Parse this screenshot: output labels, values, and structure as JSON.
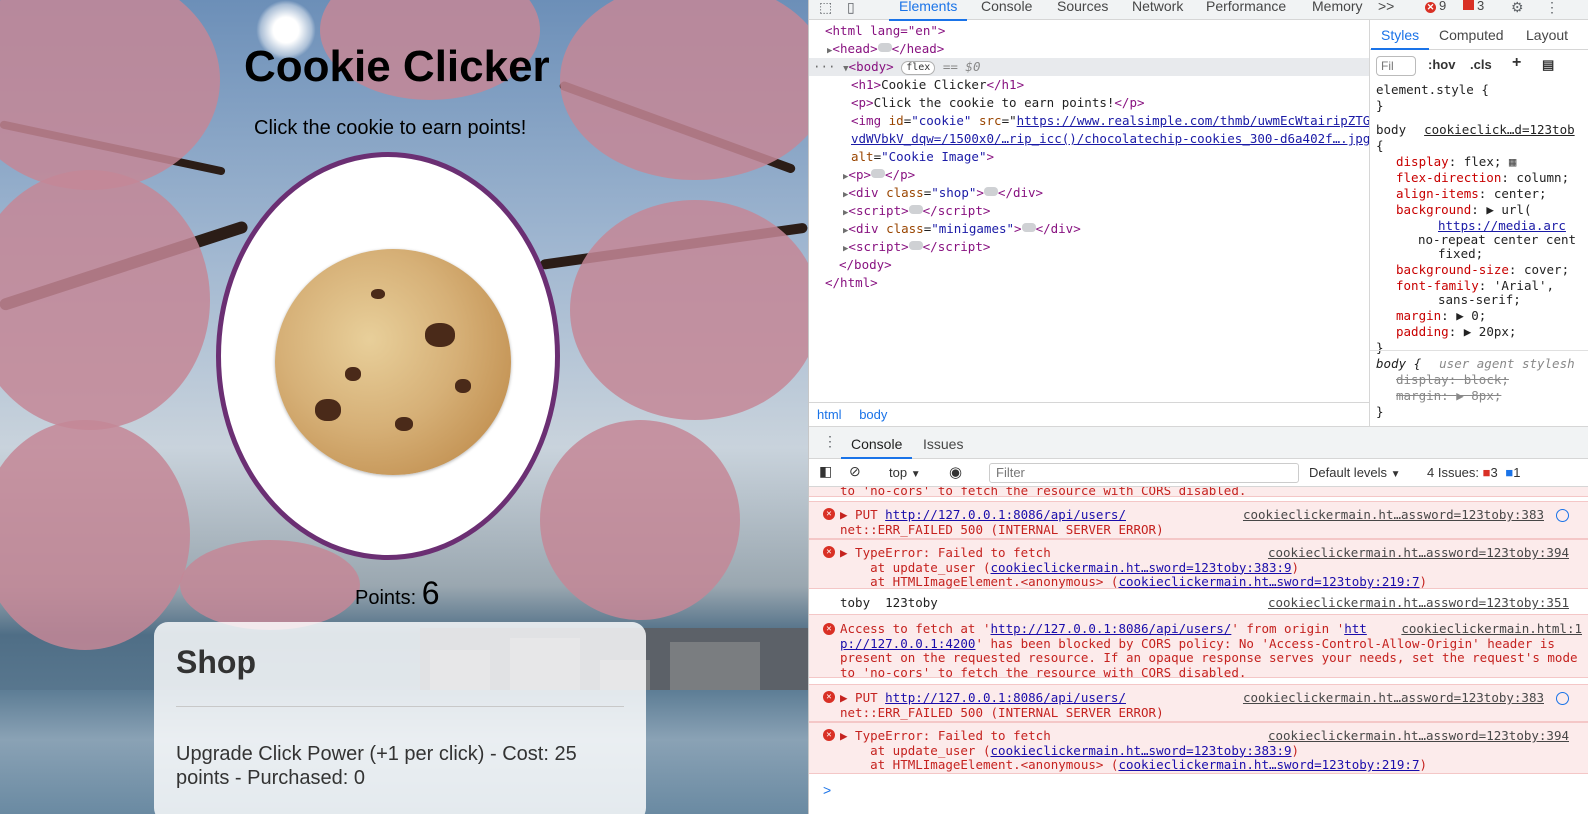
{
  "page": {
    "title": "Cookie Clicker",
    "subtitle": "Click the cookie to earn points!",
    "points_label": "Points:",
    "points_value": "6",
    "shop": {
      "title": "Shop",
      "item": "Upgrade Click Power (+1 per click) - Cost: 25 points - Purchased: 0"
    }
  },
  "devtools": {
    "tabs": [
      "Elements",
      "Console",
      "Sources",
      "Network",
      "Performance",
      "Memory"
    ],
    "active_tab": "Elements",
    "more_tabs": ">>",
    "error_count": "9",
    "warning_count": "3",
    "dom": {
      "html_open": "<html lang=\"en\">",
      "head": "head",
      "body_tag": "body",
      "body_pill": "flex",
      "body_eq": "== $0",
      "h1_open": "<h1>",
      "h1_text": "Cookie Clicker",
      "h1_close": "</h1>",
      "p_open": "<p>",
      "p_text": "Click the cookie to earn points!",
      "p_close": "</p>",
      "img_prefix": "<img ",
      "img_id_attr": "id",
      "img_id_val": "\"cookie\"",
      "img_src_attr": "src",
      "img_src_1": "https://www.realsimple.com/thmb/uwmEcWtairipZTGa",
      "img_src_2": "vdWVbkV_dqw=/1500x0/…rip_icc()/chocolatechip-cookies_300-d6a402f….jpg",
      "img_alt_attr": "alt",
      "img_alt_val": "\"Cookie Image\"",
      "img_close": ">",
      "p2": "p",
      "div_shop_class": "\"shop\"",
      "script": "script",
      "div_mini_class": "\"minigames\"",
      "body_close": "</body>",
      "html_close": "</html>"
    },
    "breadcrumbs": [
      "html",
      "body"
    ],
    "styles": {
      "tabs": [
        "Styles",
        "Computed",
        "Layout"
      ],
      "filter_placeholder": "Fil",
      "hov": ":hov",
      "cls": ".cls",
      "element_style": "element.style {",
      "close_brace": "}",
      "body_selector": "body",
      "body_source": "cookieclick…d=123tob",
      "open_brace": "{",
      "rules": [
        {
          "name": "display",
          "value": "flex;"
        },
        {
          "name": "flex-direction",
          "value": "column;"
        },
        {
          "name": "align-items",
          "value": "center;"
        },
        {
          "name": "background",
          "value": "▶ url("
        },
        {
          "name": "",
          "value": "https://media.arc"
        },
        {
          "name": "",
          "value": "no-repeat center cent"
        },
        {
          "name": "",
          "value": "fixed;"
        },
        {
          "name": "background-size",
          "value": "cover;"
        },
        {
          "name": "font-family",
          "value": "'Arial',"
        },
        {
          "name": "",
          "value": "sans-serif;"
        },
        {
          "name": "margin",
          "value": "▶ 0;"
        },
        {
          "name": "padding",
          "value": "▶ 20px;"
        }
      ],
      "ua_selector": "body {",
      "ua_label": "user agent stylesh",
      "ua_rules": [
        {
          "name": "display",
          "value": "block;"
        },
        {
          "name": "margin",
          "value": "▶ 8px;"
        }
      ]
    },
    "console": {
      "tabs": [
        "Console",
        "Issues"
      ],
      "context": "top",
      "filter_placeholder": "Filter",
      "levels": "Default levels",
      "issues_label": "4 Issues:",
      "issues_errors": "3",
      "issues_info": "1",
      "partial_line": "to 'no-cors' to fetch the resource with CORS disabled.",
      "messages": [
        {
          "type": "error",
          "lines": [
            "▶ PUT ",
            "net::ERR_FAILED 500 (INTERNAL SERVER ERROR)"
          ],
          "url": "http://127.0.0.1:8086/api/users/",
          "source": "cookieclickermain.ht…assword=123toby:383"
        },
        {
          "type": "error",
          "lines": [
            "▶ TypeError: Failed to fetch",
            "    at update_user (",
            "    at HTMLImageElement.<anonymous> ("
          ],
          "links": [
            "cookieclickermain.ht…sword=123toby:383:9",
            "cookieclickermain.ht…sword=123toby:219:7"
          ],
          "source": "cookieclickermain.ht…assword=123toby:394"
        },
        {
          "type": "log",
          "text": "toby  123toby",
          "source": "cookieclickermain.ht…assword=123toby:351"
        },
        {
          "type": "error",
          "lines": [
            "Access to fetch at '",
            "' from origin '",
            "htt",
            "p://127.0.0.1:4200",
            "' has been blocked by CORS policy: No 'Access-Control-Allow-Origin' header is",
            "present on the requested resource. If an opaque response serves your needs, set the request's mode",
            "to 'no-cors' to fetch the resource with CORS disabled."
          ],
          "url": "http://127.0.0.1:8086/api/users/",
          "source": "cookieclickermain.html:1"
        },
        {
          "type": "error",
          "lines": [
            "▶ PUT ",
            "net::ERR_FAILED 500 (INTERNAL SERVER ERROR)"
          ],
          "url": "http://127.0.0.1:8086/api/users/",
          "source": "cookieclickermain.ht…assword=123toby:383"
        },
        {
          "type": "error",
          "lines": [
            "▶ TypeError: Failed to fetch",
            "    at update_user (",
            "    at HTMLImageElement.<anonymous> ("
          ],
          "links": [
            "cookieclickermain.ht…sword=123toby:383:9",
            "cookieclickermain.ht…sword=123toby:219:7"
          ],
          "source": "cookieclickermain.ht…assword=123toby:394"
        }
      ],
      "prompt": ">"
    }
  },
  "colors": {
    "accent": "#1a73e8",
    "error": "#d93025",
    "cookie_border": "#6b2f73"
  }
}
